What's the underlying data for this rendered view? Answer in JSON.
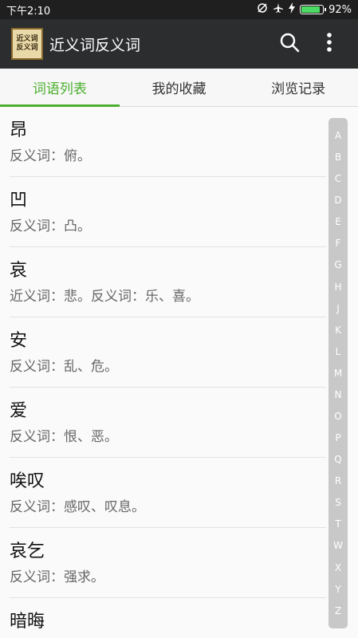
{
  "status": {
    "time": "下午2:10",
    "battery": "92%",
    "battery_fraction": 0.92
  },
  "app": {
    "title": "近义词反义词",
    "logo_line1": "近义词",
    "logo_line2": "反义词"
  },
  "tabs": [
    {
      "label": "词语列表",
      "active": true
    },
    {
      "label": "我的收藏",
      "active": false
    },
    {
      "label": "浏览记录",
      "active": false
    }
  ],
  "list": [
    {
      "word": "昂",
      "detail": "反义词：俯。"
    },
    {
      "word": "凹",
      "detail": "反义词：凸。"
    },
    {
      "word": "哀",
      "detail": "近义词：悲。反义词：乐、喜。"
    },
    {
      "word": "安",
      "detail": "反义词：乱、危。"
    },
    {
      "word": "爱",
      "detail": "反义词：恨、恶。"
    },
    {
      "word": "唉叹",
      "detail": "反义词：感叹、叹息。"
    },
    {
      "word": "哀乞",
      "detail": "反义词：强求。"
    },
    {
      "word": "暗晦",
      "detail": ""
    }
  ],
  "index_letters": [
    "A",
    "B",
    "C",
    "D",
    "E",
    "F",
    "G",
    "H",
    "J",
    "K",
    "L",
    "M",
    "N",
    "O",
    "P",
    "Q",
    "R",
    "S",
    "T",
    "W",
    "X",
    "Y",
    "Z"
  ],
  "colors": {
    "accent": "#4caf2f",
    "app_bar": "#2b2d2e",
    "status_bar": "#1f1f1f"
  }
}
